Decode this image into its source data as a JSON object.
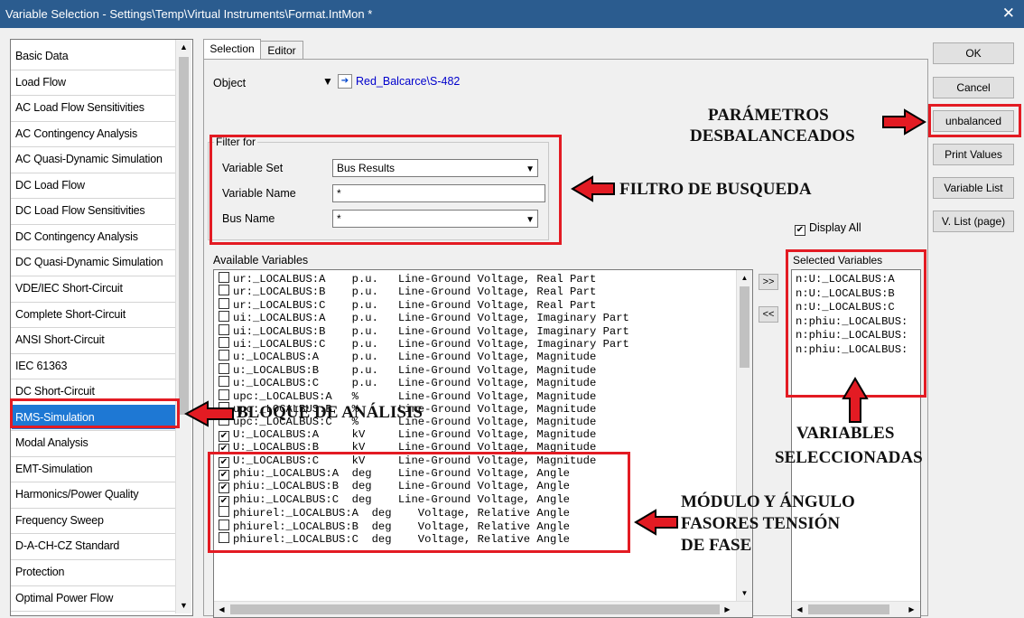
{
  "window": {
    "title": "Variable Selection - Settings\\Temp\\Virtual Instruments\\Format.IntMon *",
    "close": "✕"
  },
  "left_list": {
    "items": [
      "Basic Data",
      "Load Flow",
      "AC Load Flow Sensitivities",
      "AC Contingency Analysis",
      "AC Quasi-Dynamic Simulation",
      "DC Load Flow",
      "DC Load Flow Sensitivities",
      "DC Contingency Analysis",
      "DC Quasi-Dynamic Simulation",
      "VDE/IEC Short-Circuit",
      "Complete Short-Circuit",
      "ANSI Short-Circuit",
      "IEC 61363",
      "DC Short-Circuit",
      "RMS-Simulation",
      "Modal Analysis",
      "EMT-Simulation",
      "Harmonics/Power Quality",
      "Frequency Sweep",
      "D-A-CH-CZ Standard",
      "Protection",
      "Optimal Power Flow"
    ],
    "selected": "RMS-Simulation"
  },
  "tabs": {
    "selection": "Selection",
    "editor": "Editor"
  },
  "object": {
    "label": "Object",
    "value": "Red_Balcarce\\S-482",
    "dropdown_glyph": "▼",
    "jump_glyph": "➔"
  },
  "filter": {
    "legend": "Filter for",
    "variable_set_label": "Variable Set",
    "variable_set_value": "Bus Results",
    "variable_name_label": "Variable Name",
    "variable_name_value": "*",
    "bus_name_label": "Bus Name",
    "bus_name_value": "*"
  },
  "display_all": {
    "label": "Display All",
    "checked": true
  },
  "available": {
    "label": "Available Variables",
    "rows": [
      {
        "text": "ur:_LOCALBUS:A    p.u.   Line-Ground Voltage, Real Part",
        "checked": false
      },
      {
        "text": "ur:_LOCALBUS:B    p.u.   Line-Ground Voltage, Real Part",
        "checked": false
      },
      {
        "text": "ur:_LOCALBUS:C    p.u.   Line-Ground Voltage, Real Part",
        "checked": false
      },
      {
        "text": "ui:_LOCALBUS:A    p.u.   Line-Ground Voltage, Imaginary Part",
        "checked": false
      },
      {
        "text": "ui:_LOCALBUS:B    p.u.   Line-Ground Voltage, Imaginary Part",
        "checked": false
      },
      {
        "text": "ui:_LOCALBUS:C    p.u.   Line-Ground Voltage, Imaginary Part",
        "checked": false
      },
      {
        "text": "u:_LOCALBUS:A     p.u.   Line-Ground Voltage, Magnitude",
        "checked": false
      },
      {
        "text": "u:_LOCALBUS:B     p.u.   Line-Ground Voltage, Magnitude",
        "checked": false
      },
      {
        "text": "u:_LOCALBUS:C     p.u.   Line-Ground Voltage, Magnitude",
        "checked": false
      },
      {
        "text": "upc:_LOCALBUS:A   %      Line-Ground Voltage, Magnitude",
        "checked": false
      },
      {
        "text": "upc:_LOCALBUS:B   %      Line-Ground Voltage, Magnitude",
        "checked": false
      },
      {
        "text": "upc:_LOCALBUS:C   %      Line-Ground Voltage, Magnitude",
        "checked": false
      },
      {
        "text": "U:_LOCALBUS:A     kV     Line-Ground Voltage, Magnitude",
        "checked": true
      },
      {
        "text": "U:_LOCALBUS:B     kV     Line-Ground Voltage, Magnitude",
        "checked": true
      },
      {
        "text": "U:_LOCALBUS:C     kV     Line-Ground Voltage, Magnitude",
        "checked": true
      },
      {
        "text": "phiu:_LOCALBUS:A  deg    Line-Ground Voltage, Angle",
        "checked": true
      },
      {
        "text": "phiu:_LOCALBUS:B  deg    Line-Ground Voltage, Angle",
        "checked": true
      },
      {
        "text": "phiu:_LOCALBUS:C  deg    Line-Ground Voltage, Angle",
        "checked": true
      },
      {
        "text": "phiurel:_LOCALBUS:A  deg    Voltage, Relative Angle",
        "checked": false
      },
      {
        "text": "phiurel:_LOCALBUS:B  deg    Voltage, Relative Angle",
        "checked": false
      },
      {
        "text": "phiurel:_LOCALBUS:C  deg    Voltage, Relative Angle",
        "checked": false
      }
    ]
  },
  "move_buttons": {
    "add": ">>",
    "remove": "<<"
  },
  "selected": {
    "label": "Selected Variables",
    "rows": [
      "n:U:_LOCALBUS:A",
      "n:U:_LOCALBUS:B",
      "n:U:_LOCALBUS:C",
      "n:phiu:_LOCALBUS:",
      "n:phiu:_LOCALBUS:",
      "n:phiu:_LOCALBUS:"
    ]
  },
  "buttons": {
    "ok": "OK",
    "cancel": "Cancel",
    "unbalanced": "unbalanced",
    "print_values": "Print Values",
    "variable_list": "Variable List",
    "vlist_page": "V. List (page)"
  },
  "annotations": {
    "parametros_1": "PARÁMETROS",
    "parametros_2": "DESBALANCEADOS",
    "filtro": "FILTRO DE BUSQUEDA",
    "bloque": "BLOQUE DE ANÁLISIS",
    "variables_1": "VARIABLES",
    "variables_2": "SELECCIONADAS",
    "modulo_1": "MÓDULO Y ÁNGULO",
    "modulo_2": "FASORES TENSIÓN",
    "modulo_3": "DE FASE"
  },
  "colors": {
    "highlight": "#e31b23",
    "selection": "#1e78d4",
    "link": "#0000cc"
  }
}
